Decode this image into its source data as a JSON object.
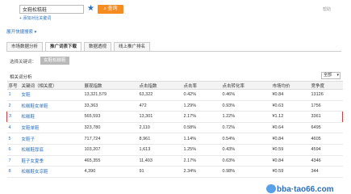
{
  "search": {
    "value": "女鞋松糕鞋",
    "button_label": "查询"
  },
  "top_right_link": "帮助",
  "add_compare": "+ 添加对比关键词",
  "expand_link": "展开快捷搜索",
  "tabs": [
    {
      "label": "市场数据分析"
    },
    {
      "label": "推广词表下载"
    },
    {
      "label": "数据透视"
    },
    {
      "label": "线上推广排名"
    }
  ],
  "keyword_label": "选择关键词：",
  "keyword_chip": "女鞋松糕鞋",
  "section_title": "相关词分析",
  "select_value": "全部",
  "columns": [
    "序号",
    "关键词（相关度）",
    "展现指数",
    "点击指数",
    "点击率",
    "点击转化率",
    "市场均价",
    "竞争度"
  ],
  "rows": [
    [
      "1",
      "女鞋",
      "13,321,579",
      "63,322",
      "0.42%",
      "0.46%",
      "¥0.84",
      "13126"
    ],
    [
      "2",
      "松糕鞋女单鞋",
      "33,363",
      "472",
      "1.29%",
      "0.93%",
      "¥0.63",
      "1756"
    ],
    [
      "3",
      "松糕鞋",
      "565,593",
      "13,301",
      "2.17%",
      "1.22%",
      "¥1.12",
      "3361"
    ],
    [
      "4",
      "女鞋单鞋",
      "323,780",
      "2,110",
      "0.58%",
      "0.72%",
      "¥0.64",
      "6495"
    ],
    [
      "5",
      "女鞋子",
      "717,724",
      "8,961",
      "1.14%",
      "0.54%",
      "¥0.84",
      "4605"
    ],
    [
      "6",
      "松糕鞋厚底",
      "103,207",
      "1,613",
      "1.25%",
      "0.43%",
      "¥0.59",
      "4594"
    ],
    [
      "7",
      "鞋子女夏季",
      "465,355",
      "11,403",
      "2.17%",
      "0.63%",
      "¥0.84",
      "4346"
    ],
    [
      "8",
      "松糕鞋女凉鞋",
      "4,390",
      "91",
      "2.34%",
      "0.98%",
      "¥0.59",
      "344"
    ]
  ],
  "watermark": "bba·tao66.com"
}
